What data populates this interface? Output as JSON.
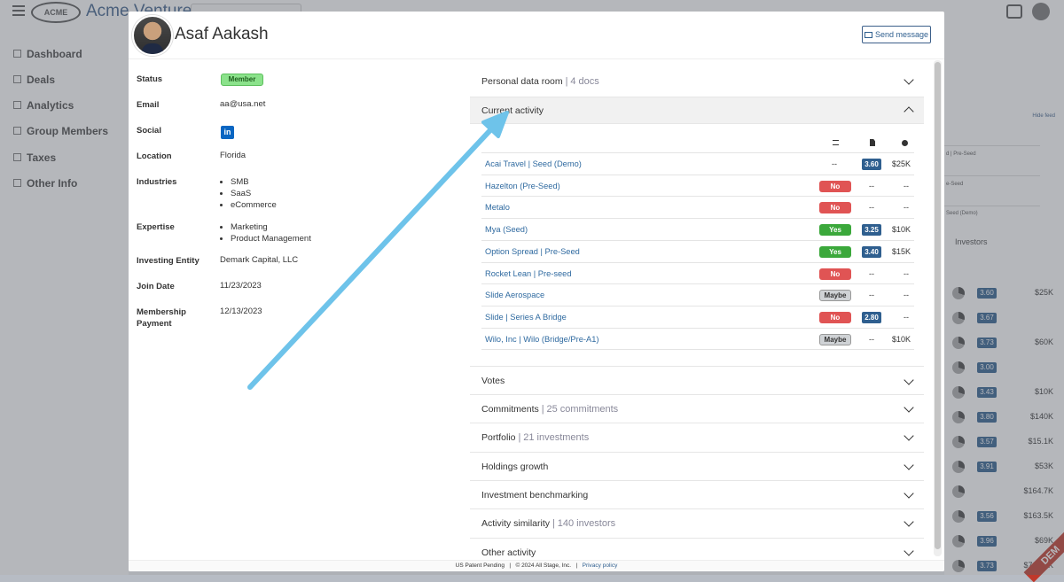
{
  "app": {
    "brand": "Acme Venture",
    "logo_text": "ACME",
    "sidebar": [
      {
        "label": "Dashboard"
      },
      {
        "label": "Deals"
      },
      {
        "label": "Analytics"
      },
      {
        "label": "Group Members"
      },
      {
        "label": "Taxes"
      },
      {
        "label": "Other Info"
      }
    ],
    "right_panel": {
      "hide_feed": "Hide feed",
      "feed_snippets": [
        "d | Pre-Seed",
        "e-Seed",
        "Seed (Demo)"
      ],
      "investors_label": "Investors",
      "rows": [
        {
          "score": "3.60",
          "amount": "$25K"
        },
        {
          "score": "3.67",
          "amount": ""
        },
        {
          "score": "3.73",
          "amount": "$60K"
        },
        {
          "score": "3.00",
          "amount": ""
        },
        {
          "score": "3.43",
          "amount": "$10K"
        },
        {
          "score": "3.80",
          "amount": "$140K"
        },
        {
          "score": "3.57",
          "amount": "$15.1K"
        },
        {
          "score": "3.91",
          "amount": "$53K"
        },
        {
          "score": "",
          "amount": "$164.7K"
        },
        {
          "score": "3.56",
          "amount": "$163.5K"
        },
        {
          "score": "3.96",
          "amount": "$69K"
        },
        {
          "score": "3.73",
          "amount": "$700.3K"
        }
      ],
      "ribbon": "DEM"
    }
  },
  "modal": {
    "name": "Asaf Aakash",
    "send_message_label": "Send message",
    "fields": {
      "status_label": "Status",
      "status_value": "Member",
      "email_label": "Email",
      "email_value": "aa@usa.net",
      "social_label": "Social",
      "social_icon": "linkedin-icon",
      "location_label": "Location",
      "location_value": "Florida",
      "industries_label": "Industries",
      "industries": [
        "SMB",
        "SaaS",
        "eCommerce"
      ],
      "expertise_label": "Expertise",
      "expertise": [
        "Marketing",
        "Product Management"
      ],
      "investing_entity_label": "Investing Entity",
      "investing_entity_value": "Demark Capital, LLC",
      "join_date_label": "Join Date",
      "join_date_value": "11/23/2023",
      "membership_payment_label": "Membership Payment",
      "membership_payment_value": "12/13/2023"
    },
    "sections": {
      "data_room": {
        "title": "Personal data room",
        "count": "4 docs"
      },
      "current_activity": {
        "title": "Current activity",
        "header_icons": [
          "list-icon",
          "document-icon",
          "info-icon"
        ],
        "rows": [
          {
            "name": "Acai Travel | Seed (Demo)",
            "vote": "",
            "vote_type": "",
            "score": "3.60",
            "amount": "$25K"
          },
          {
            "name": "Hazelton (Pre-Seed)",
            "vote": "No",
            "vote_type": "no",
            "score": "",
            "amount": ""
          },
          {
            "name": "Metalo",
            "vote": "No",
            "vote_type": "no",
            "score": "",
            "amount": ""
          },
          {
            "name": "Mya (Seed)",
            "vote": "Yes",
            "vote_type": "yes",
            "score": "3.25",
            "amount": "$10K"
          },
          {
            "name": "Option Spread | Pre-Seed",
            "vote": "Yes",
            "vote_type": "yes",
            "score": "3.40",
            "amount": "$15K"
          },
          {
            "name": "Rocket Lean | Pre-seed",
            "vote": "No",
            "vote_type": "no",
            "score": "",
            "amount": ""
          },
          {
            "name": "Slide Aerospace",
            "vote": "Maybe",
            "vote_type": "maybe",
            "score": "",
            "amount": ""
          },
          {
            "name": "Slide | Series A Bridge",
            "vote": "No",
            "vote_type": "no",
            "score": "2.80",
            "amount": ""
          },
          {
            "name": "Wilo, Inc | Wilo (Bridge/Pre-A1)",
            "vote": "Maybe",
            "vote_type": "maybe",
            "score": "",
            "amount": "$10K"
          }
        ]
      },
      "votes": {
        "title": "Votes"
      },
      "commitments": {
        "title": "Commitments",
        "count": "25 commitments"
      },
      "portfolio": {
        "title": "Portfolio",
        "count": "21 investments"
      },
      "holdings_growth": {
        "title": "Holdings growth"
      },
      "investment_benchmarking": {
        "title": "Investment benchmarking"
      },
      "activity_similarity": {
        "title": "Activity similarity",
        "count": "140 investors"
      },
      "other_activity": {
        "title": "Other activity"
      }
    },
    "footer": {
      "patent": "US Patent Pending",
      "copyright": "© 2024 All Stage, Inc.",
      "privacy": "Privacy policy"
    }
  },
  "colors": {
    "accent": "#2f5f8f",
    "arrow": "#6ec3ea",
    "vote_no": "#e05454",
    "vote_yes": "#3ba83b",
    "member_badge": "#8be28b"
  }
}
